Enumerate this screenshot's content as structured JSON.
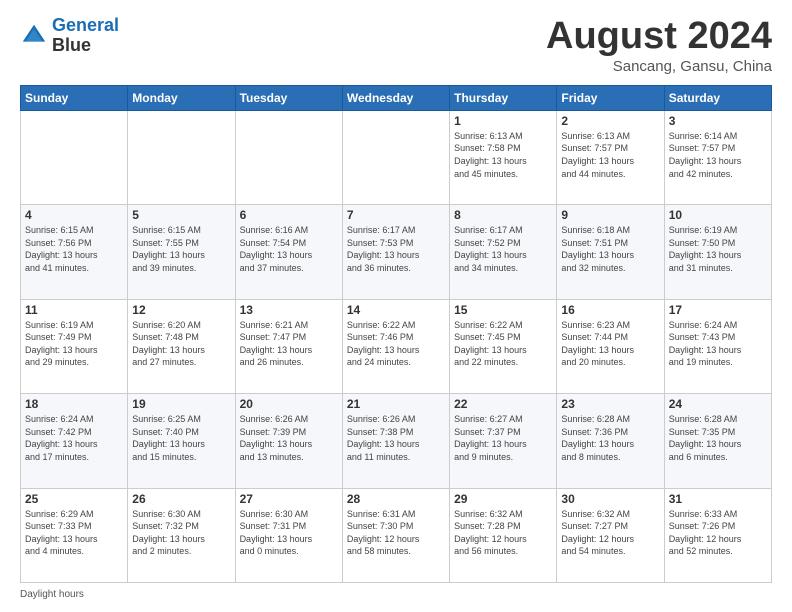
{
  "header": {
    "logo_line1": "General",
    "logo_line2": "Blue",
    "month_title": "August 2024",
    "subtitle": "Sancang, Gansu, China"
  },
  "days_of_week": [
    "Sunday",
    "Monday",
    "Tuesday",
    "Wednesday",
    "Thursday",
    "Friday",
    "Saturday"
  ],
  "weeks": [
    [
      {
        "day": "",
        "info": ""
      },
      {
        "day": "",
        "info": ""
      },
      {
        "day": "",
        "info": ""
      },
      {
        "day": "",
        "info": ""
      },
      {
        "day": "1",
        "info": "Sunrise: 6:13 AM\nSunset: 7:58 PM\nDaylight: 13 hours\nand 45 minutes."
      },
      {
        "day": "2",
        "info": "Sunrise: 6:13 AM\nSunset: 7:57 PM\nDaylight: 13 hours\nand 44 minutes."
      },
      {
        "day": "3",
        "info": "Sunrise: 6:14 AM\nSunset: 7:57 PM\nDaylight: 13 hours\nand 42 minutes."
      }
    ],
    [
      {
        "day": "4",
        "info": "Sunrise: 6:15 AM\nSunset: 7:56 PM\nDaylight: 13 hours\nand 41 minutes."
      },
      {
        "day": "5",
        "info": "Sunrise: 6:15 AM\nSunset: 7:55 PM\nDaylight: 13 hours\nand 39 minutes."
      },
      {
        "day": "6",
        "info": "Sunrise: 6:16 AM\nSunset: 7:54 PM\nDaylight: 13 hours\nand 37 minutes."
      },
      {
        "day": "7",
        "info": "Sunrise: 6:17 AM\nSunset: 7:53 PM\nDaylight: 13 hours\nand 36 minutes."
      },
      {
        "day": "8",
        "info": "Sunrise: 6:17 AM\nSunset: 7:52 PM\nDaylight: 13 hours\nand 34 minutes."
      },
      {
        "day": "9",
        "info": "Sunrise: 6:18 AM\nSunset: 7:51 PM\nDaylight: 13 hours\nand 32 minutes."
      },
      {
        "day": "10",
        "info": "Sunrise: 6:19 AM\nSunset: 7:50 PM\nDaylight: 13 hours\nand 31 minutes."
      }
    ],
    [
      {
        "day": "11",
        "info": "Sunrise: 6:19 AM\nSunset: 7:49 PM\nDaylight: 13 hours\nand 29 minutes."
      },
      {
        "day": "12",
        "info": "Sunrise: 6:20 AM\nSunset: 7:48 PM\nDaylight: 13 hours\nand 27 minutes."
      },
      {
        "day": "13",
        "info": "Sunrise: 6:21 AM\nSunset: 7:47 PM\nDaylight: 13 hours\nand 26 minutes."
      },
      {
        "day": "14",
        "info": "Sunrise: 6:22 AM\nSunset: 7:46 PM\nDaylight: 13 hours\nand 24 minutes."
      },
      {
        "day": "15",
        "info": "Sunrise: 6:22 AM\nSunset: 7:45 PM\nDaylight: 13 hours\nand 22 minutes."
      },
      {
        "day": "16",
        "info": "Sunrise: 6:23 AM\nSunset: 7:44 PM\nDaylight: 13 hours\nand 20 minutes."
      },
      {
        "day": "17",
        "info": "Sunrise: 6:24 AM\nSunset: 7:43 PM\nDaylight: 13 hours\nand 19 minutes."
      }
    ],
    [
      {
        "day": "18",
        "info": "Sunrise: 6:24 AM\nSunset: 7:42 PM\nDaylight: 13 hours\nand 17 minutes."
      },
      {
        "day": "19",
        "info": "Sunrise: 6:25 AM\nSunset: 7:40 PM\nDaylight: 13 hours\nand 15 minutes."
      },
      {
        "day": "20",
        "info": "Sunrise: 6:26 AM\nSunset: 7:39 PM\nDaylight: 13 hours\nand 13 minutes."
      },
      {
        "day": "21",
        "info": "Sunrise: 6:26 AM\nSunset: 7:38 PM\nDaylight: 13 hours\nand 11 minutes."
      },
      {
        "day": "22",
        "info": "Sunrise: 6:27 AM\nSunset: 7:37 PM\nDaylight: 13 hours\nand 9 minutes."
      },
      {
        "day": "23",
        "info": "Sunrise: 6:28 AM\nSunset: 7:36 PM\nDaylight: 13 hours\nand 8 minutes."
      },
      {
        "day": "24",
        "info": "Sunrise: 6:28 AM\nSunset: 7:35 PM\nDaylight: 13 hours\nand 6 minutes."
      }
    ],
    [
      {
        "day": "25",
        "info": "Sunrise: 6:29 AM\nSunset: 7:33 PM\nDaylight: 13 hours\nand 4 minutes."
      },
      {
        "day": "26",
        "info": "Sunrise: 6:30 AM\nSunset: 7:32 PM\nDaylight: 13 hours\nand 2 minutes."
      },
      {
        "day": "27",
        "info": "Sunrise: 6:30 AM\nSunset: 7:31 PM\nDaylight: 13 hours\nand 0 minutes."
      },
      {
        "day": "28",
        "info": "Sunrise: 6:31 AM\nSunset: 7:30 PM\nDaylight: 12 hours\nand 58 minutes."
      },
      {
        "day": "29",
        "info": "Sunrise: 6:32 AM\nSunset: 7:28 PM\nDaylight: 12 hours\nand 56 minutes."
      },
      {
        "day": "30",
        "info": "Sunrise: 6:32 AM\nSunset: 7:27 PM\nDaylight: 12 hours\nand 54 minutes."
      },
      {
        "day": "31",
        "info": "Sunrise: 6:33 AM\nSunset: 7:26 PM\nDaylight: 12 hours\nand 52 minutes."
      }
    ]
  ],
  "footer": {
    "label": "Daylight hours"
  }
}
